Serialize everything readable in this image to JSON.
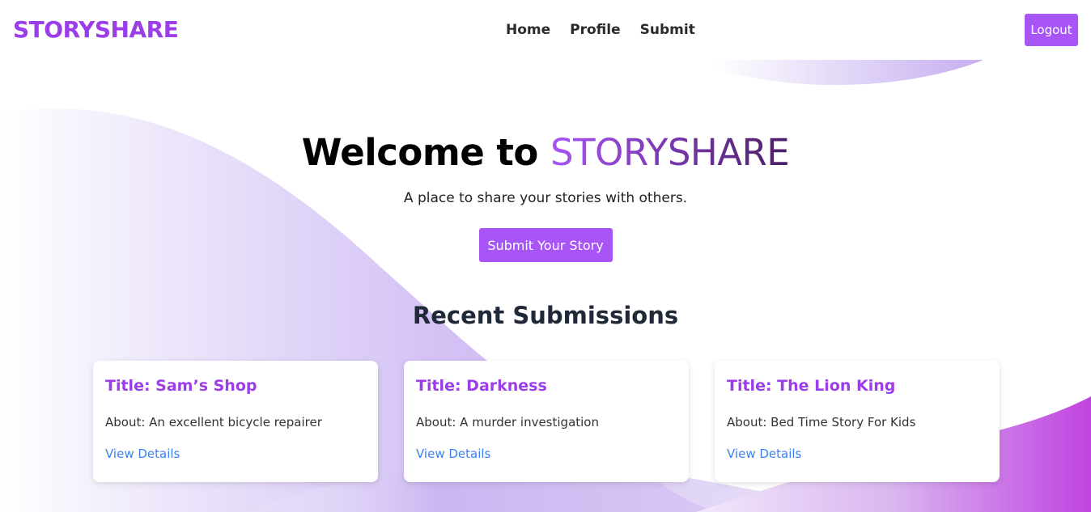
{
  "navbar": {
    "brand": "STORYSHARE",
    "links": [
      "Home",
      "Profile",
      "Submit"
    ],
    "logout_label": "Logout"
  },
  "hero": {
    "title_prefix": "Welcome to ",
    "title_brand": "STORYSHARE",
    "subtitle": "A place to share your stories with others.",
    "cta_label": "Submit Your Story"
  },
  "recent": {
    "heading": "Recent Submissions",
    "cards": [
      {
        "title": "Title: Sam’s Shop",
        "about": "About: An excellent bicycle repairer",
        "link": "View Details"
      },
      {
        "title": "Title: Darkness",
        "about": "About: A murder investigation",
        "link": "View Details"
      },
      {
        "title": "Title: The Lion King",
        "about": "About: Bed Time Story For Kids",
        "link": "View Details"
      }
    ]
  },
  "colors": {
    "brand": "#9b3de8",
    "button": "#a855f7",
    "link": "#3b82f6",
    "wave_light": "#e6dcfa",
    "wave_dark": "#c043e0"
  }
}
